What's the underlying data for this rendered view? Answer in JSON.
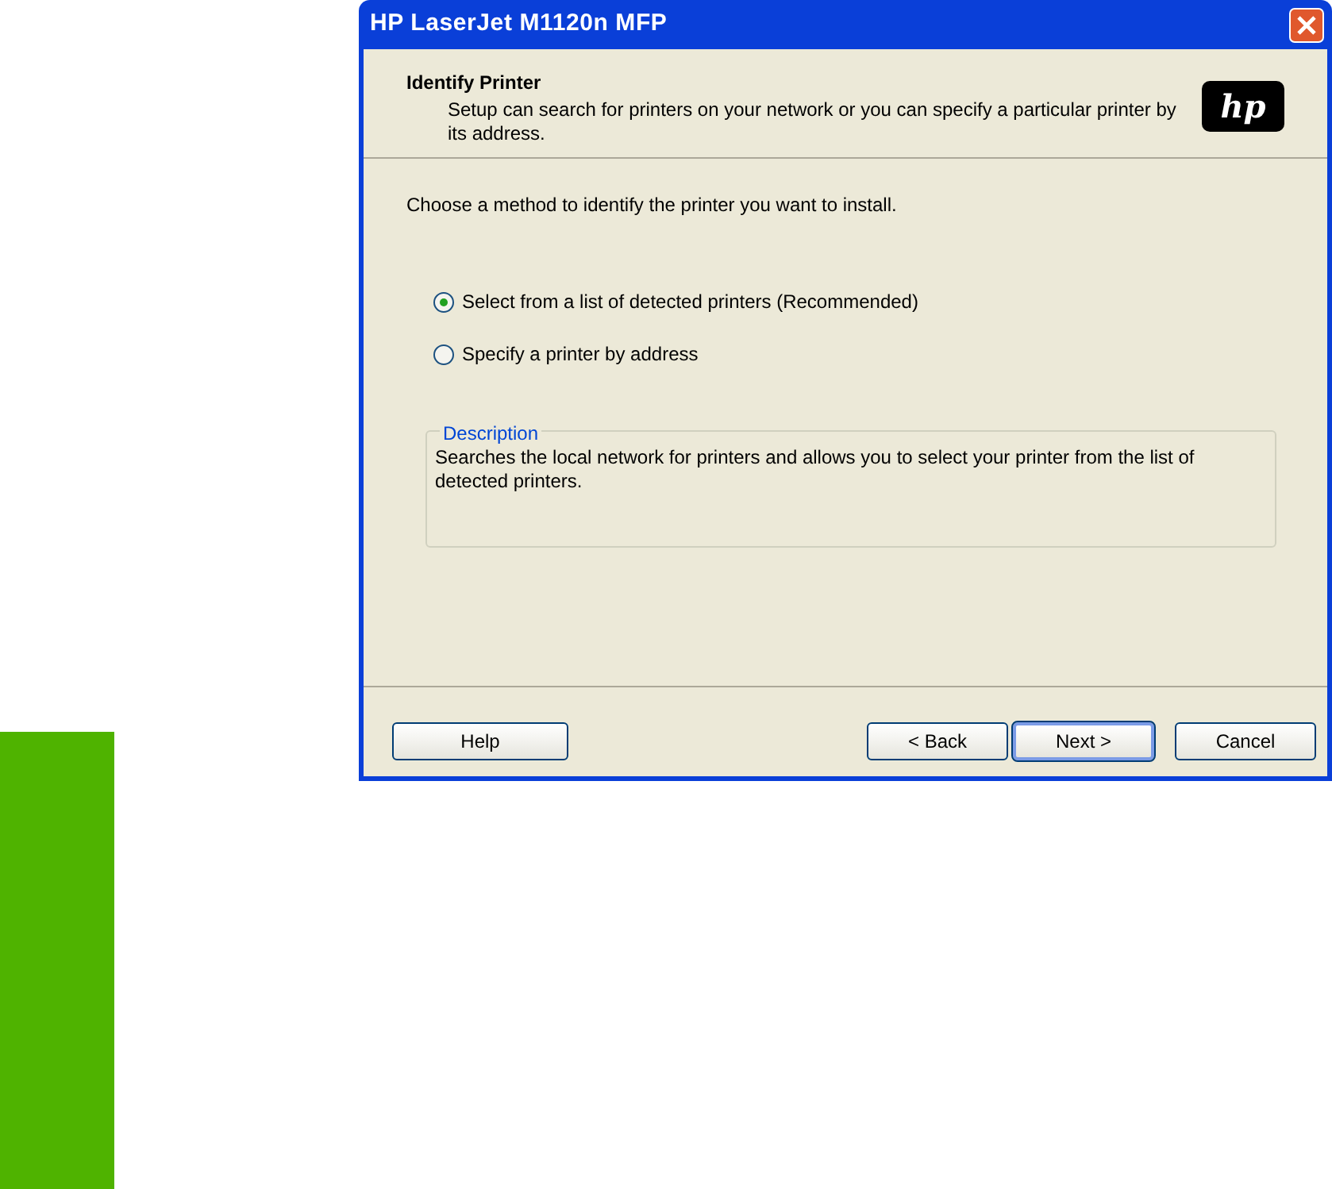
{
  "window": {
    "title": "HP LaserJet M1120n MFP"
  },
  "header": {
    "title": "Identify Printer",
    "subtitle": "Setup can search for printers on your network or you can specify a particular printer by its address.",
    "logo_text": "hp"
  },
  "prompt": "Choose a method to identify the printer you want to install.",
  "options": [
    {
      "label": "Select from a list of detected printers (Recommended)",
      "selected": true
    },
    {
      "label": "Specify a printer by address",
      "selected": false
    }
  ],
  "description": {
    "legend": "Description",
    "text": "Searches the local network for printers and allows you to select your printer from the list of detected printers."
  },
  "buttons": [
    {
      "label": "Help",
      "default": false
    },
    {
      "label": "< Back",
      "default": false
    },
    {
      "label": "Next >",
      "default": true
    },
    {
      "label": "Cancel",
      "default": false
    }
  ]
}
